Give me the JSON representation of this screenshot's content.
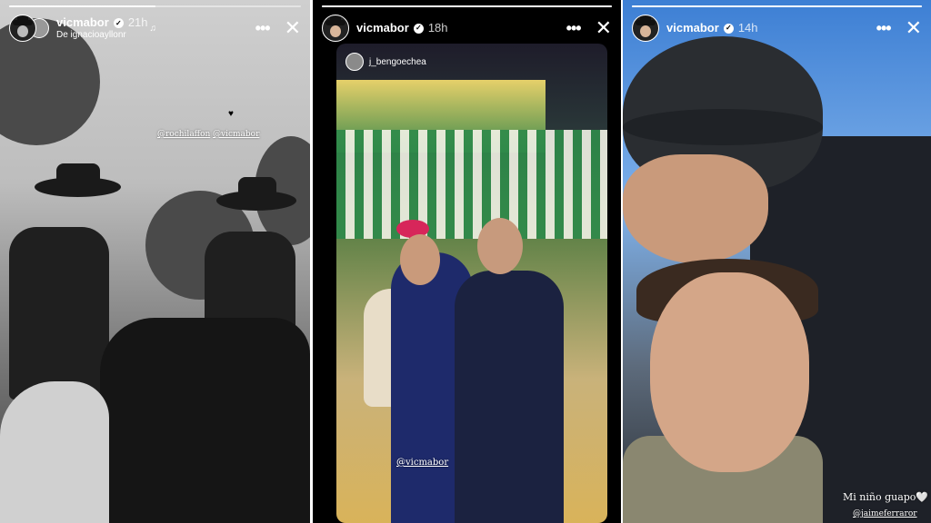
{
  "stories": [
    {
      "username": "vicmabor",
      "time": "21h",
      "subtitle": "De ignacioayllonr",
      "music_icon": "♫",
      "progress": 0.5,
      "tags": [
        "@rochilaffon",
        "@vicmabor"
      ],
      "heart": "♥"
    },
    {
      "username": "vicmabor",
      "time": "18h",
      "shared_from": "j_bengoechea",
      "progress": 1.0,
      "tags": [
        "@vicmabor"
      ]
    },
    {
      "username": "vicmabor",
      "time": "14h",
      "progress": 1.0,
      "caption": "Mi niño guapo🤍",
      "tags": [
        "@jaimeferraror"
      ]
    }
  ],
  "icons": {
    "verified": "✓",
    "more": "•••",
    "close": "✕"
  }
}
